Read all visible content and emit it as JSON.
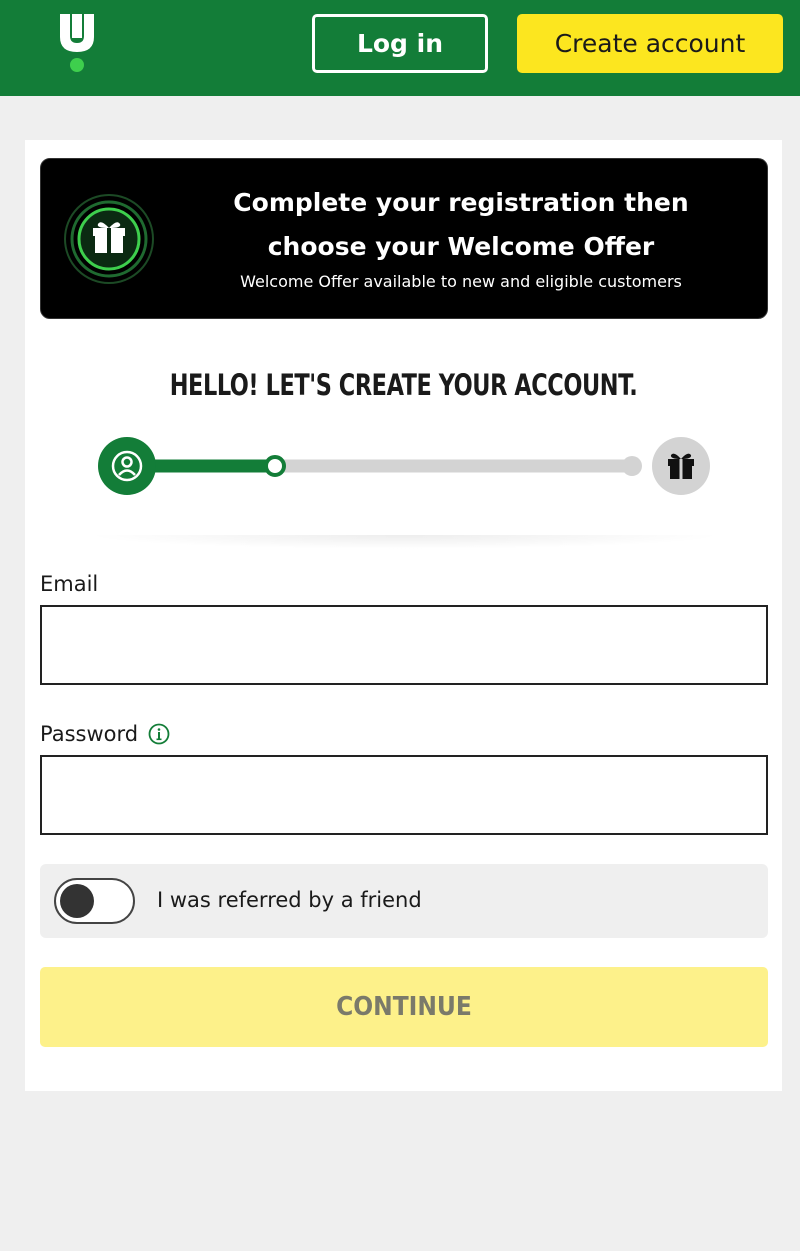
{
  "header": {
    "login_label": "Log in",
    "create_account_label": "Create account",
    "brand_color": "#137d38",
    "accent_color": "#fce61f"
  },
  "banner": {
    "title": "Complete your registration then choose your Welcome Offer",
    "subtitle": "Welcome Offer available to new and eligible customers",
    "icon": "gift-icon"
  },
  "form": {
    "heading": "HELLO! LET'S CREATE YOUR ACCOUNT.",
    "progress": {
      "current_step": 1,
      "total_steps": 2,
      "fraction_complete": 0.27,
      "start_icon": "user-icon",
      "end_icon": "gift-icon"
    },
    "email_label": "Email",
    "email_value": "",
    "password_label": "Password",
    "password_value": "",
    "password_info_icon": "info-icon",
    "referral_label": "I was referred by a friend",
    "referral_toggle_on": false,
    "continue_label": "CONTINUE"
  }
}
